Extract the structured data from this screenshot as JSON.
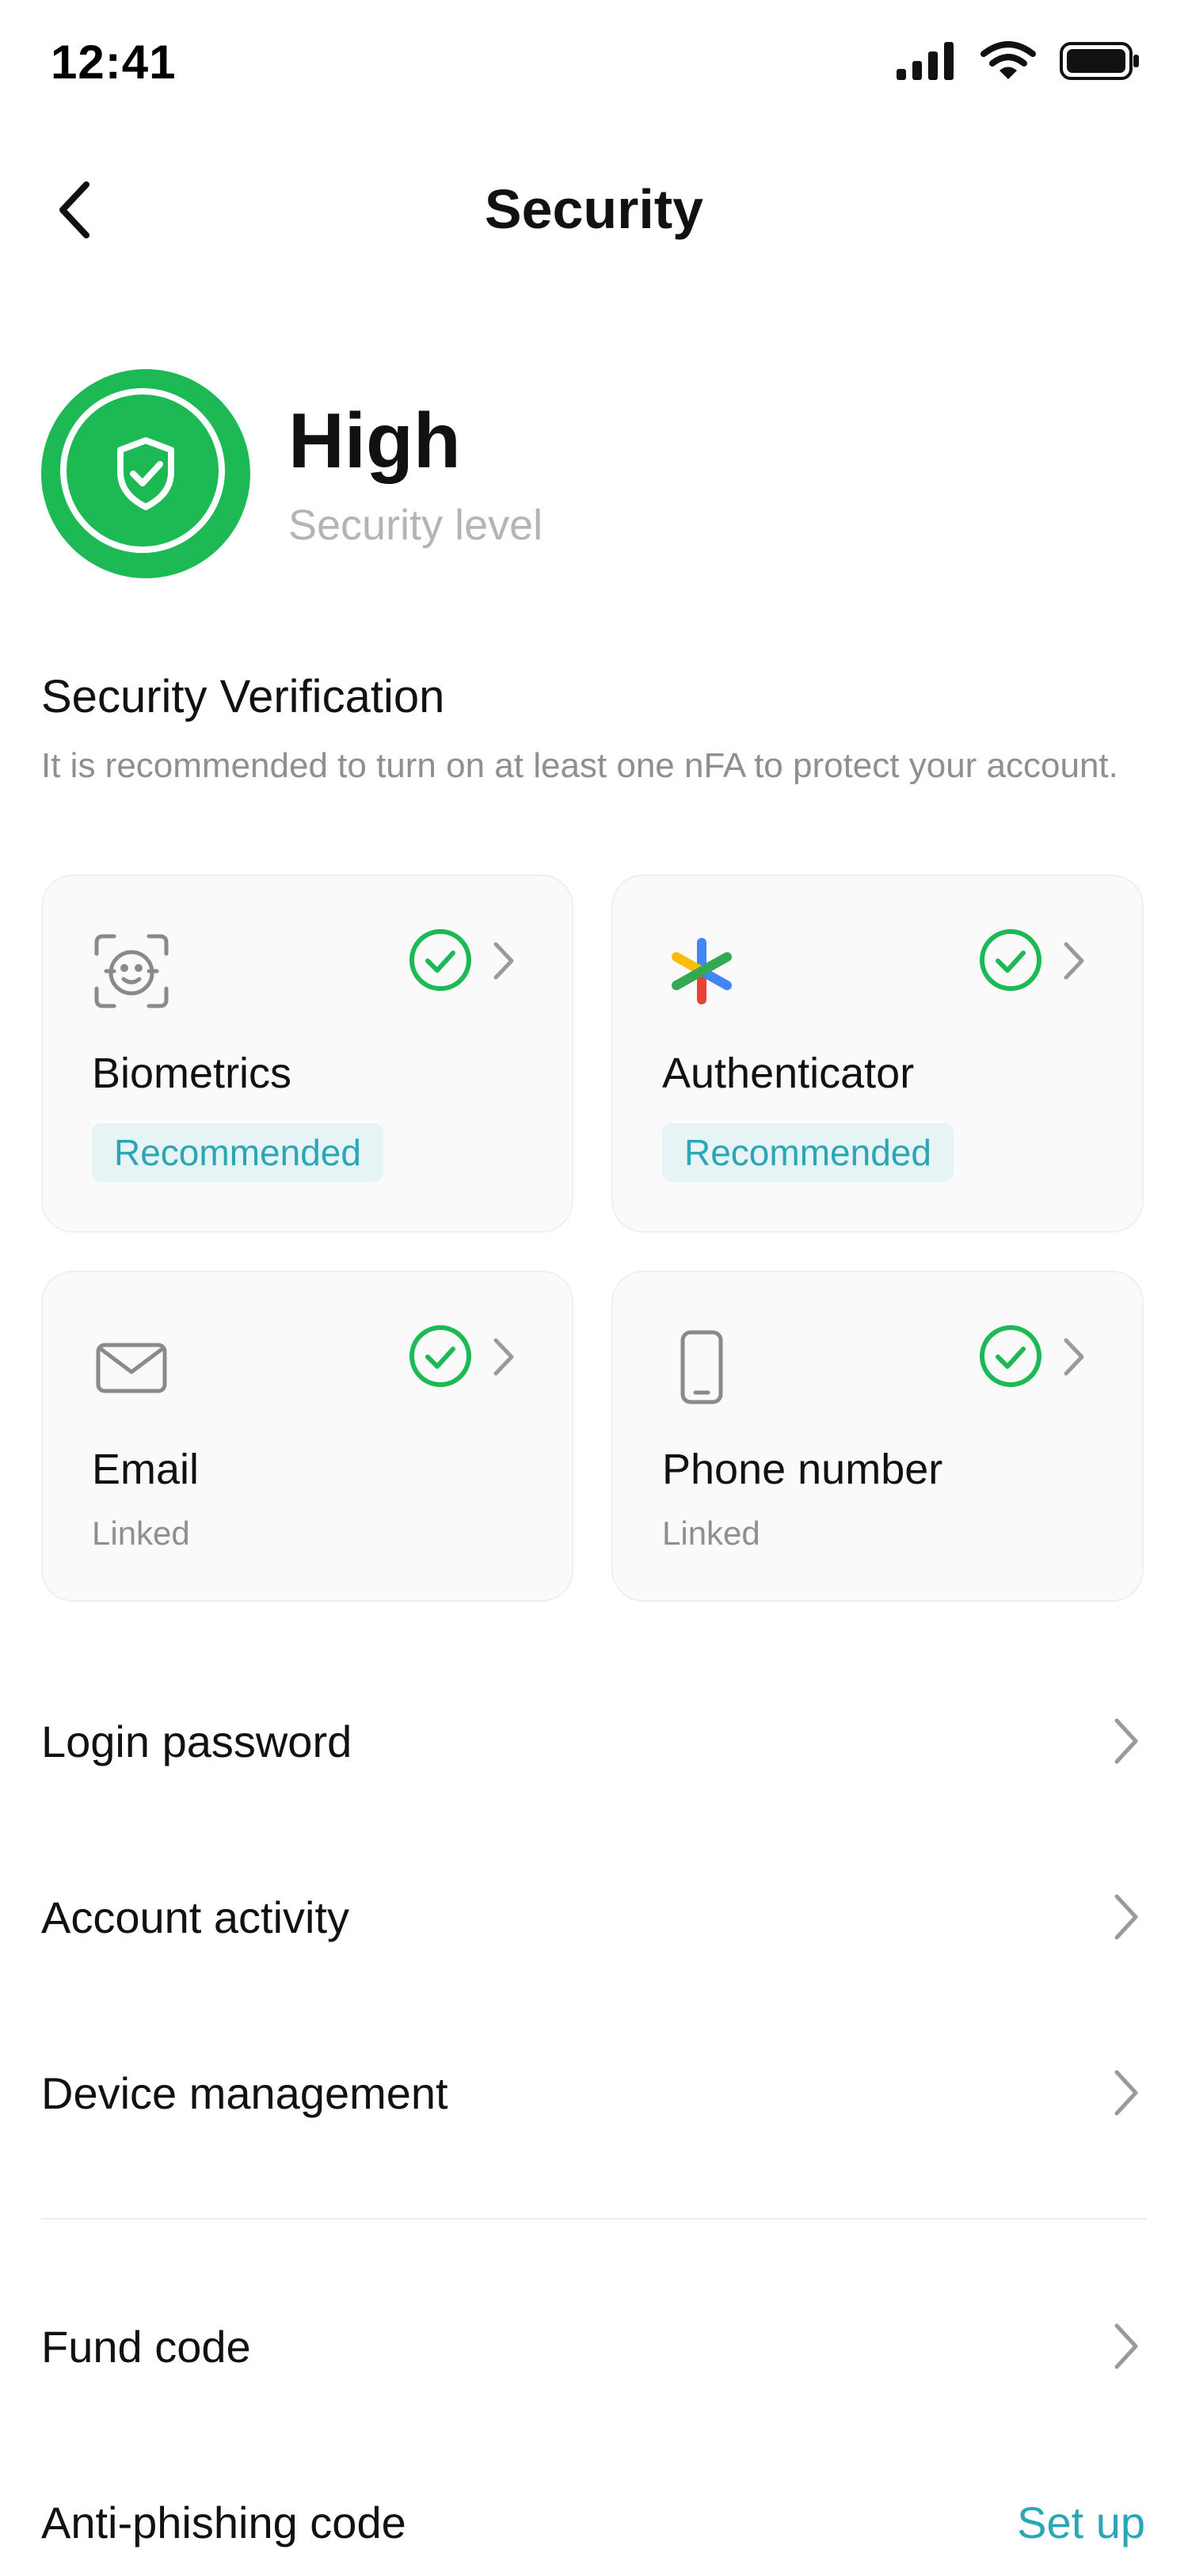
{
  "status_bar": {
    "time": "12:41"
  },
  "header": {
    "title": "Security"
  },
  "security_level": {
    "value": "High",
    "label": "Security level",
    "color": "#1db954"
  },
  "verification": {
    "title": "Security Verification",
    "description": "It is recommended to turn on at least one nFA to protect your account.",
    "cards": [
      {
        "title": "Biometrics",
        "badge": "Recommended",
        "icon": "face-id-icon",
        "enabled": true
      },
      {
        "title": "Authenticator",
        "badge": "Recommended",
        "icon": "authenticator-icon",
        "enabled": true
      },
      {
        "title": "Email",
        "subtitle": "Linked",
        "icon": "mail-icon",
        "enabled": true
      },
      {
        "title": "Phone number",
        "subtitle": "Linked",
        "icon": "phone-icon",
        "enabled": true
      }
    ]
  },
  "menu": {
    "login_password": "Login password",
    "account_activity": "Account activity",
    "device_management": "Device management",
    "fund_code": "Fund code",
    "anti_phishing": {
      "label": "Anti-phishing code",
      "action": "Set up"
    }
  },
  "colors": {
    "accent": "#2aa6b6",
    "success": "#1db954"
  }
}
